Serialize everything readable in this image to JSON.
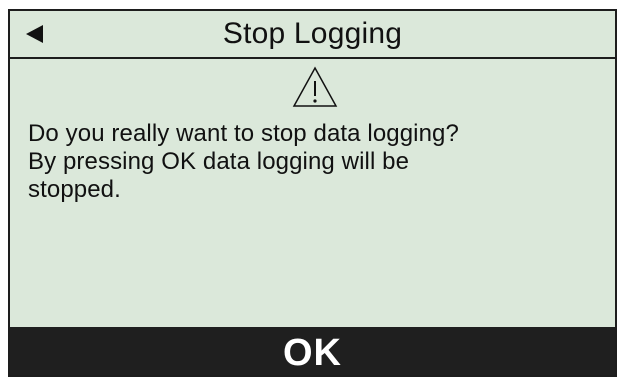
{
  "dialog": {
    "title": "Stop Logging",
    "message_lines": [
      "Do you really want to stop data logging?",
      "By pressing OK data logging will be",
      "stopped."
    ],
    "ok_label": "OK"
  },
  "icons": {
    "back": "back-arrow-icon",
    "warning": "warning-icon"
  },
  "colors": {
    "screen_background": "#dbe8da",
    "text": "#111111",
    "ok_bar_background": "#1f1f1f",
    "ok_text": "#ffffff",
    "border": "#1d1d1d"
  }
}
